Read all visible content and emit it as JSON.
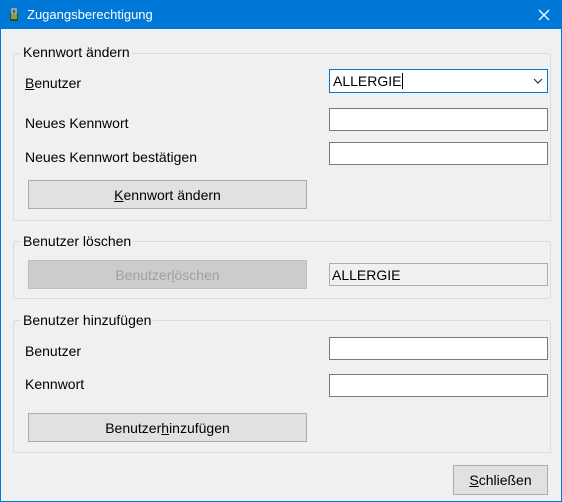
{
  "window": {
    "title": "Zugangsberechtigung",
    "icon": "app-icon",
    "close_icon": "close-icon"
  },
  "change_password": {
    "legend": "Kennwort ändern",
    "user_label_pre": "",
    "user_label_accel": "B",
    "user_label_post": "enutzer",
    "user_value": "ALLERGIE",
    "new_password_label": "Neues Kennwort",
    "confirm_password_label": "Neues Kennwort bestätigen",
    "button_pre": "",
    "button_accel": "K",
    "button_post": "ennwort ändern"
  },
  "delete_user": {
    "legend": "Benutzer löschen",
    "button_pre": "Benutzer ",
    "button_accel": "l",
    "button_post": "öschen",
    "user_value": "ALLERGIE"
  },
  "add_user": {
    "legend": "Benutzer hinzufügen",
    "user_label": "Benutzer",
    "password_label": "Kennwort",
    "button_pre": "Benutzer ",
    "button_accel": "h",
    "button_post": "inzufügen"
  },
  "footer": {
    "close_pre": "",
    "close_accel": "S",
    "close_post": "chließen"
  },
  "colors": {
    "titlebar": "#0078d7",
    "background": "#f0f0f0",
    "focus_border": "#0078d7"
  }
}
